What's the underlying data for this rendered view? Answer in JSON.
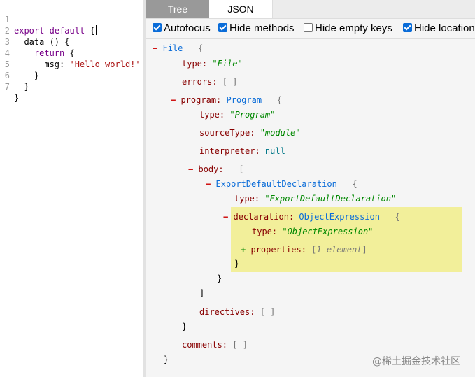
{
  "editor": {
    "lines": [
      {
        "num": "1"
      },
      {
        "num": "2"
      },
      {
        "num": "3"
      },
      {
        "num": "4"
      },
      {
        "num": "5"
      },
      {
        "num": "6"
      },
      {
        "num": "7"
      }
    ],
    "tokens": {
      "export": "export",
      "default": "default",
      "brace_open": "{",
      "data_fn": "data () {",
      "return": "return",
      "return_brace": " {",
      "msg_key": "msg: ",
      "msg_value": "'Hello world!'",
      "close_inner": "}",
      "close_fn": "}",
      "close_outer": "}"
    }
  },
  "tabs": {
    "tree": "Tree",
    "json": "JSON"
  },
  "options": {
    "autofocus": "Autofocus",
    "hide_methods": "Hide methods",
    "hide_empty_keys": "Hide empty keys",
    "hide_location": "Hide location"
  },
  "ast": {
    "minus": "−",
    "plus": "+",
    "file": "File",
    "open_brace": "{",
    "close_brace": "}",
    "open_bracket": "[",
    "close_bracket": "]",
    "empty_array": "[ ]",
    "type_key": "type: ",
    "file_type": "\"File\"",
    "errors_key": "errors: ",
    "program_key": "program: ",
    "program_node": "Program",
    "program_type": "\"Program\"",
    "source_type_key": "sourceType: ",
    "source_type_value": "\"module\"",
    "interpreter_key": "interpreter: ",
    "interpreter_value": "null",
    "body_key": "body: ",
    "export_node": "ExportDefaultDeclaration",
    "export_type": "\"ExportDefaultDeclaration\"",
    "declaration_key": "declaration: ",
    "object_node": "ObjectExpression",
    "object_type": "\"ObjectExpression\"",
    "properties_key": "properties: ",
    "properties_summary": "1 element",
    "directives_key": "directives: ",
    "comments_key": "comments: "
  },
  "watermark": "@稀土掘金技术社区"
}
